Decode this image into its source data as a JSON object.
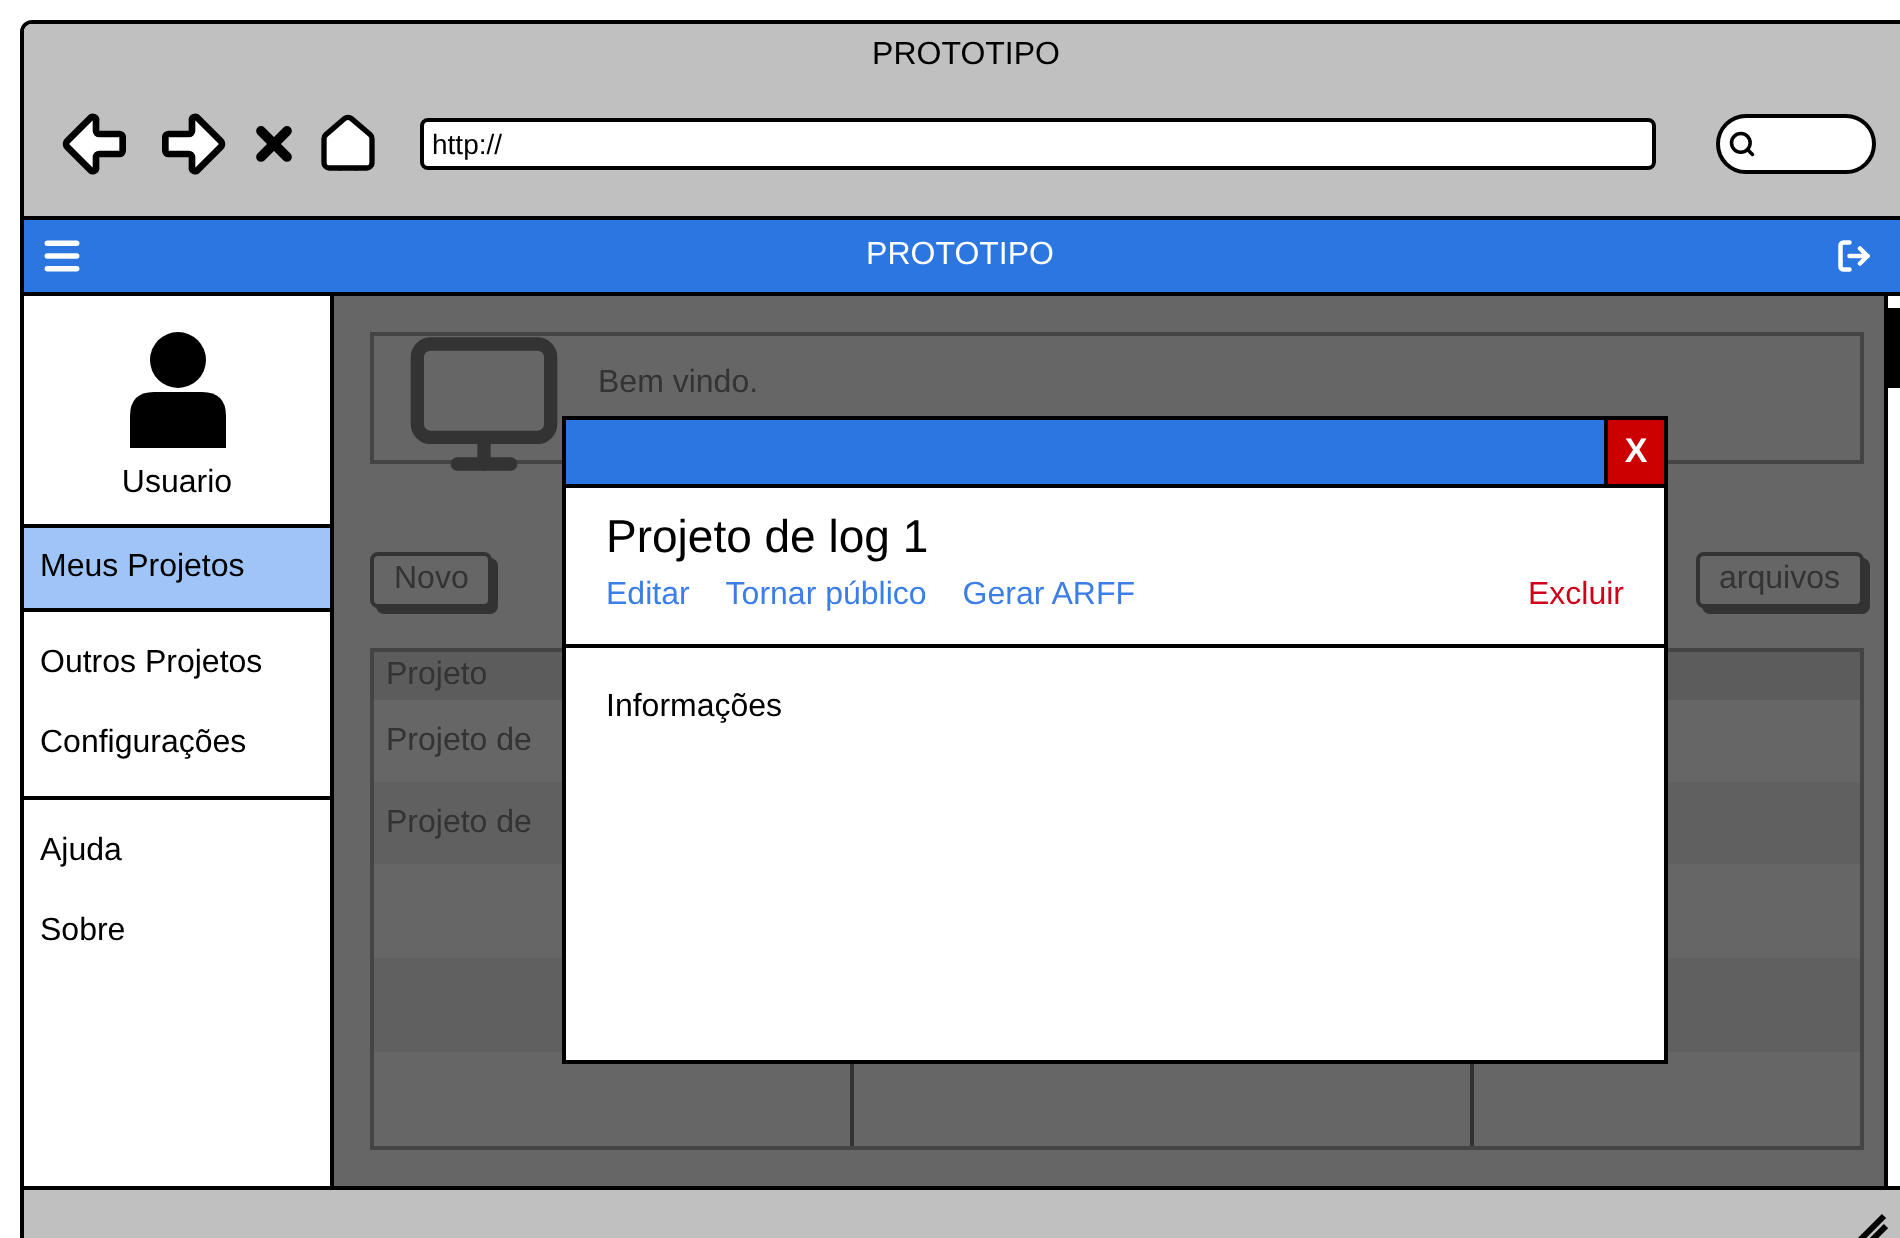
{
  "browser": {
    "title": "PROTOTIPO",
    "url": "http://"
  },
  "app_bar": {
    "title": "PROTOTIPO"
  },
  "sidebar": {
    "user": "Usuario",
    "groups": [
      {
        "items": [
          {
            "label": "Meus Projetos",
            "selected": true
          }
        ]
      },
      {
        "items": [
          {
            "label": "Outros Projetos",
            "selected": false
          },
          {
            "label": "Configurações",
            "selected": false
          }
        ]
      },
      {
        "items": [
          {
            "label": "Ajuda",
            "selected": false
          },
          {
            "label": "Sobre",
            "selected": false
          }
        ]
      }
    ]
  },
  "background": {
    "welcome": "Bem vindo.",
    "buttons": [
      "Novo",
      "arquivos"
    ],
    "table": {
      "columns": [
        "Projeto"
      ],
      "rows": [
        "Projeto de",
        "Projeto de"
      ]
    }
  },
  "dialog": {
    "close": "X",
    "title": "Projeto de log 1",
    "actions": [
      {
        "label": "Editar",
        "kind": "link"
      },
      {
        "label": "Tornar público",
        "kind": "link"
      },
      {
        "label": "Gerar ARFF",
        "kind": "link"
      },
      {
        "label": "Excluir",
        "kind": "danger"
      }
    ],
    "section": "Informações"
  }
}
